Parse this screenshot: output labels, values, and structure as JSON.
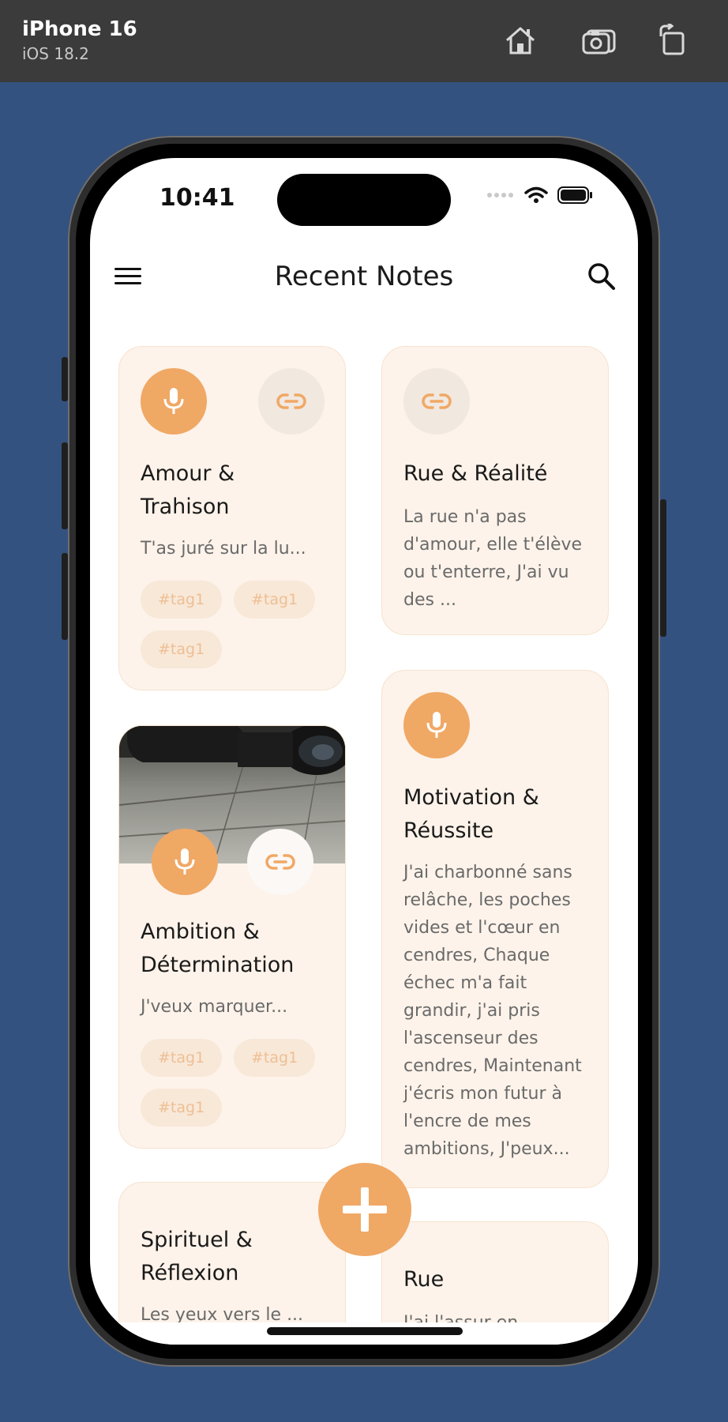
{
  "simulator": {
    "device_name": "iPhone 16",
    "os_version": "iOS 18.2",
    "icons": [
      "home-icon",
      "screenshot-icon",
      "rotate-icon"
    ]
  },
  "status_bar": {
    "time": "10:41"
  },
  "header": {
    "title": "Recent Notes",
    "menu_icon": "hamburger-icon",
    "search_icon": "search-icon"
  },
  "notes": [
    {
      "title": "Amour & Trahison",
      "excerpt": "T'as juré sur la lu...",
      "tags": [
        "#tag1",
        "#tag1",
        "#tag1"
      ],
      "has_audio": true,
      "has_link": true
    },
    {
      "title": "Rue & Réalité",
      "excerpt": "La rue n'a pas d'amour, elle t'élève ou t'enterre, J'ai vu des ...",
      "tags": [],
      "has_audio": false,
      "has_link": true
    },
    {
      "title": "Ambition & Détermination",
      "excerpt": "J'veux marquer...",
      "tags": [
        "#tag1",
        "#tag1",
        "#tag1"
      ],
      "has_audio": true,
      "has_link": true,
      "has_image": true
    },
    {
      "title": "Motivation & Réussite",
      "excerpt": "J'ai charbonné sans relâche, les poches vides et l'cœur en cendres, Chaque échec m'a fait grandir, j'ai pris l'ascenseur des cendres, Maintenant j'écris mon futur à l'encre de mes ambitions, J'peux...",
      "tags": [],
      "has_audio": true,
      "has_link": false
    },
    {
      "title": "Spirituel & Réflexion",
      "excerpt": "Les yeux vers le ...",
      "tags": []
    },
    {
      "title": "Rue",
      "excerpt": "J'ai l'assur en ...",
      "tags": []
    }
  ],
  "fab": {
    "icon": "plus-icon"
  },
  "colors": {
    "accent": "#f0a865",
    "card_bg": "#fdf3ea",
    "tag_bg": "#f8e8d8",
    "tag_text": "#eebf94",
    "backdrop": "#34527f"
  }
}
